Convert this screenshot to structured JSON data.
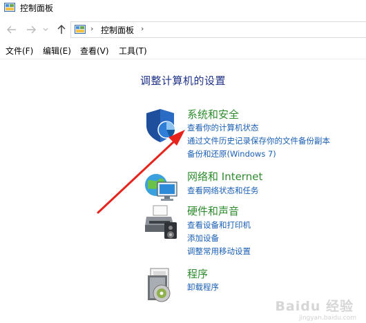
{
  "window": {
    "title": "控制面板"
  },
  "navigation": {
    "back_icon": "arrow-left-icon",
    "forward_icon": "arrow-right-icon",
    "recent_icon": "chevron-down-icon",
    "up_icon": "arrow-up-icon",
    "breadcrumb": [
      "控制面板"
    ]
  },
  "menu": {
    "items": [
      "文件(F)",
      "编辑(E)",
      "查看(V)",
      "工具(T)"
    ]
  },
  "main": {
    "heading": "调整计算机的设置",
    "categories": [
      {
        "title": "系统和安全",
        "icon": "shield-icon",
        "links": [
          "查看你的计算机状态",
          "通过文件历史记录保存你的文件备份副本",
          "备份和还原(Windows 7)"
        ]
      },
      {
        "title": "网络和 Internet",
        "icon": "network-globe-icon",
        "links": [
          "查看网络状态和任务"
        ]
      },
      {
        "title": "硬件和声音",
        "icon": "printer-speaker-icon",
        "links": [
          "查看设备和打印机",
          "添加设备",
          "调整常用移动设置"
        ]
      },
      {
        "title": "程序",
        "icon": "programs-disc-icon",
        "links": [
          "卸载程序"
        ]
      }
    ]
  },
  "annotation": {
    "arrow_color": "#e8231c"
  },
  "watermark": {
    "text": "Baidu 经验",
    "sub": "jingyan.baidu.com"
  },
  "colors": {
    "category_title": "#2e8b2e",
    "link": "#1a5fb4",
    "heading": "#1e3287"
  }
}
